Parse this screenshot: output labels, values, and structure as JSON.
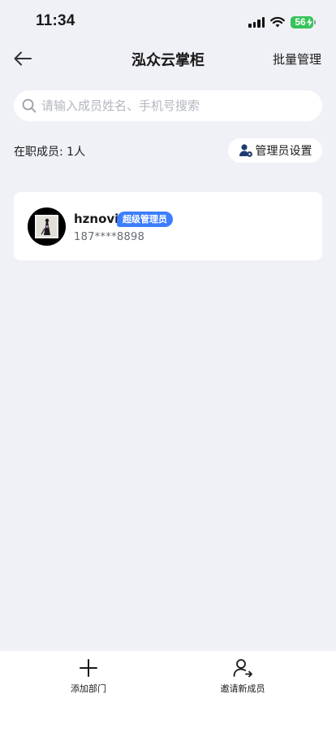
{
  "status_bar": {
    "time": "11:34",
    "battery": "56"
  },
  "nav": {
    "back_icon": "arrow-left-icon",
    "title": "泓众云掌柜",
    "action": "批量管理"
  },
  "search": {
    "placeholder": "请输入成员姓名、手机号搜索",
    "icon": "search-icon"
  },
  "summary": {
    "count_text": "在职成员: 1人",
    "admin_settings_label": "管理员设置",
    "admin_icon": "user-gear-icon"
  },
  "members": [
    {
      "name": "hznovi",
      "role": "超级管理员",
      "phone": "187****8898"
    }
  ],
  "bottom_bar": {
    "items": [
      {
        "label": "添加部门",
        "icon": "plus-icon"
      },
      {
        "label": "邀请新成员",
        "icon": "invite-user-icon"
      }
    ]
  },
  "colors": {
    "accent": "#3d7dff",
    "background": "#f0f1f6",
    "battery": "#37c359"
  }
}
